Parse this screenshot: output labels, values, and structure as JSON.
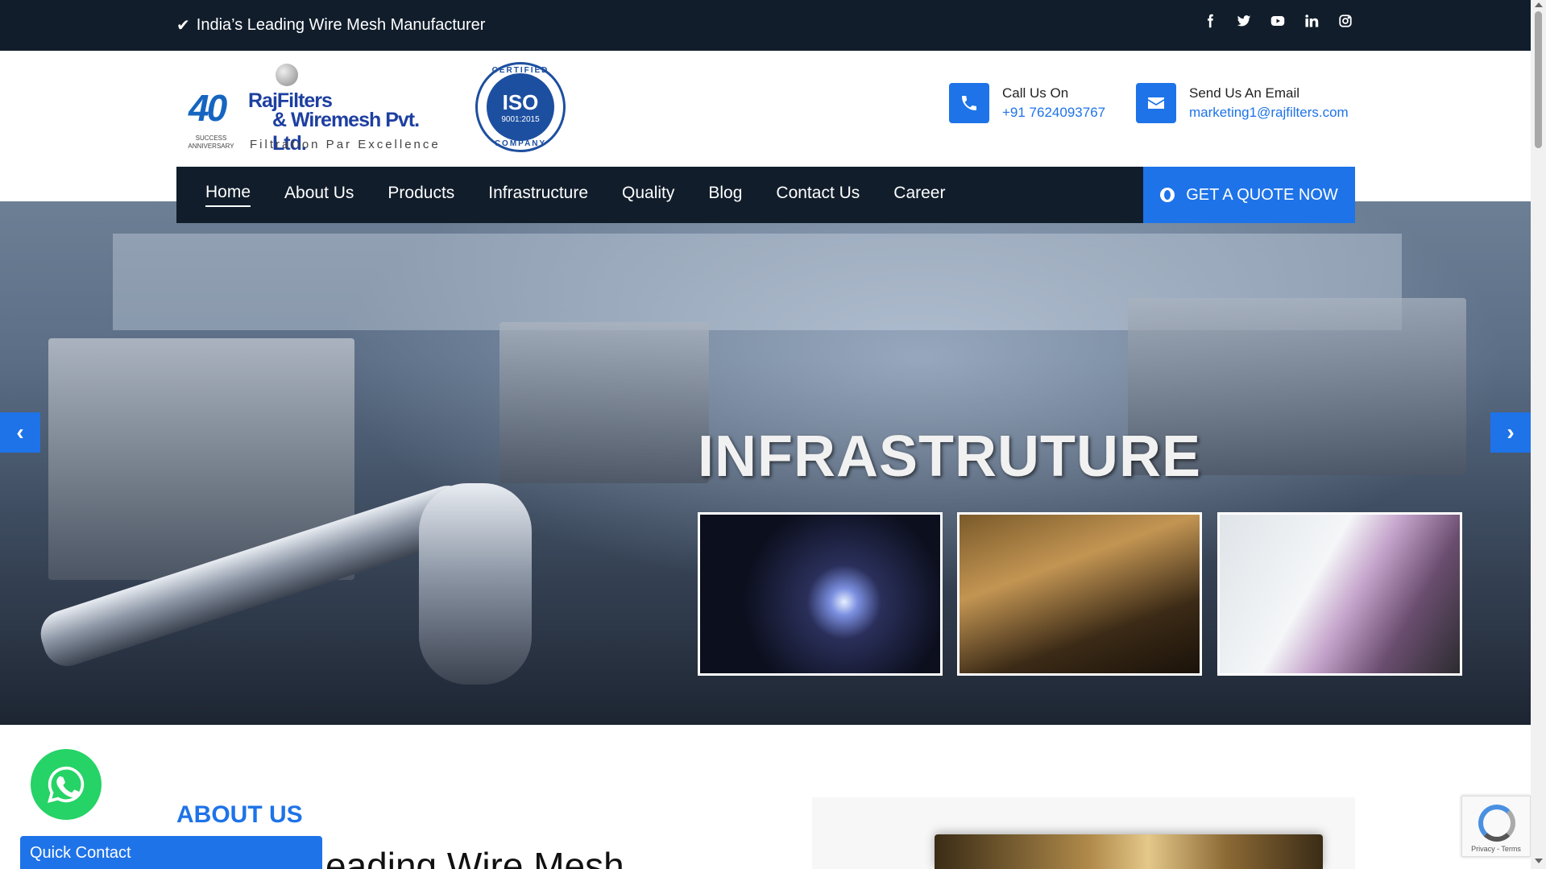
{
  "topbar": {
    "tagline": "India’s Leading Wire Mesh Manufacturer",
    "social": [
      "facebook-icon",
      "twitter-icon",
      "youtube-icon",
      "linkedin-icon",
      "instagram-icon"
    ]
  },
  "logo": {
    "forty": "40",
    "anniversary": "SUCCESS ANNIVERSARY",
    "brand_line1": "RajFilters",
    "brand_line2": "& Wiremesh Pvt. Ltd.",
    "slogan": "Filtration Par Excellence"
  },
  "iso_badge": {
    "top": "CERTIFIED",
    "main": "ISO",
    "sub": "9001:2015",
    "bottom": "COMPANY"
  },
  "contact": {
    "phone_label": "Call Us On",
    "phone_value": "+91 7624093767",
    "email_label": "Send Us An Email",
    "email_value": "marketing1@rajfilters.com"
  },
  "nav": {
    "items": [
      {
        "label": "Home",
        "active": true
      },
      {
        "label": "About Us"
      },
      {
        "label": "Products"
      },
      {
        "label": "Infrastructure"
      },
      {
        "label": "Quality"
      },
      {
        "label": "Blog"
      },
      {
        "label": "Contact Us"
      },
      {
        "label": "Career"
      }
    ],
    "quote_button": "GET A QUOTE NOW"
  },
  "hero": {
    "headline": "INFRASTRUTURE"
  },
  "about": {
    "label": "ABOUT US",
    "heading_partial": "eading Wire Mesh"
  },
  "widgets": {
    "quick_contact": "Quick Contact",
    "recaptcha_text": "Privacy - Terms"
  },
  "colors": {
    "dark": "#111d2b",
    "accent": "#1e73e8",
    "whatsapp": "#25d366"
  }
}
